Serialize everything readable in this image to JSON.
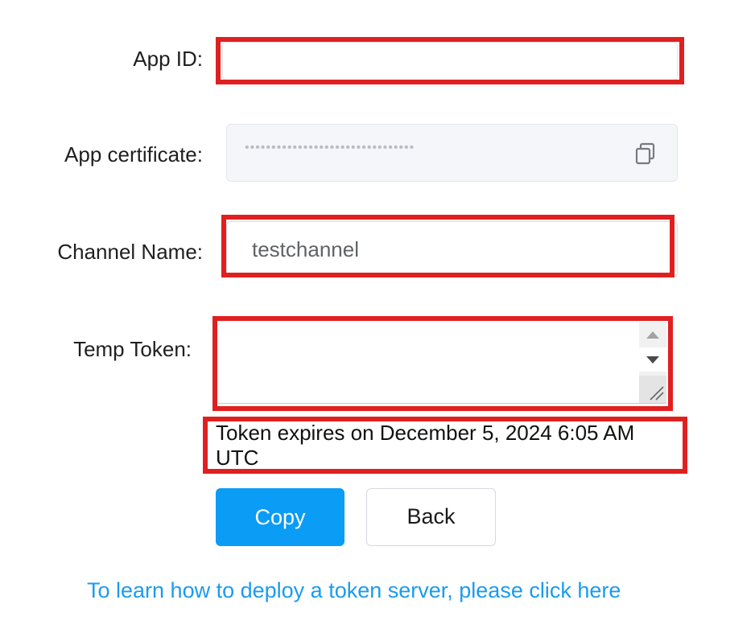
{
  "form": {
    "app_id": {
      "label": "App ID:",
      "value": ""
    },
    "app_certificate": {
      "label": "App certificate:",
      "masked_value": "••••••••••••••••••••••••••••••••",
      "copy_icon": "copy-icon"
    },
    "channel_name": {
      "label": "Channel Name:",
      "value": "testchannel"
    },
    "temp_token": {
      "label": "Temp Token:",
      "value": ""
    },
    "expiry_text": "Token expires on December 5, 2024 6:05 AM UTC"
  },
  "actions": {
    "copy_label": "Copy",
    "back_label": "Back"
  },
  "footer": {
    "link_text": "To learn how to deploy a token server, please click here"
  },
  "colors": {
    "highlight_border": "#e02020",
    "primary": "#0b9cf6",
    "link": "#1a9bf0"
  }
}
